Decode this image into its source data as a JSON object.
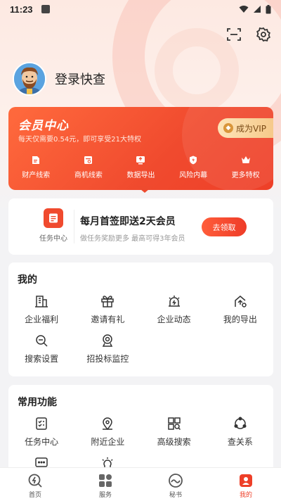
{
  "status_bar": {
    "time": "11:23"
  },
  "profile": {
    "login_text": "登录快查"
  },
  "vip": {
    "title": "会员中心",
    "subtitle": "每天仅需要0.54元，即可享受21大特权",
    "button_label": "成为VIP",
    "perks": [
      {
        "label": "财产线索",
        "icon": "property-icon"
      },
      {
        "label": "商机线索",
        "icon": "business-lead-icon"
      },
      {
        "label": "数据导出",
        "icon": "export-icon"
      },
      {
        "label": "风险内幕",
        "icon": "risk-shield-icon"
      },
      {
        "label": "更多特权",
        "icon": "crown-icon"
      }
    ]
  },
  "task": {
    "label": "任务中心",
    "title": "每月首签即送2天会员",
    "description": "做任务奖励更多 最高可得3年会员",
    "button_label": "去领取"
  },
  "mine": {
    "title": "我的",
    "items": [
      {
        "label": "企业福利",
        "icon": "building-icon"
      },
      {
        "label": "邀请有礼",
        "icon": "gift-icon"
      },
      {
        "label": "企业动态",
        "icon": "alert-light-icon"
      },
      {
        "label": "我的导出",
        "icon": "cloud-export-icon"
      },
      {
        "label": "搜索设置",
        "icon": "search-settings-icon"
      },
      {
        "label": "招投标监控",
        "icon": "camera-monitor-icon"
      }
    ]
  },
  "common": {
    "title": "常用功能",
    "items": [
      {
        "label": "任务中心",
        "icon": "task-list-icon"
      },
      {
        "label": "附近企业",
        "icon": "location-pin-icon"
      },
      {
        "label": "高级搜索",
        "icon": "advanced-search-icon"
      },
      {
        "label": "查关系",
        "icon": "relation-graph-icon"
      }
    ]
  },
  "bottom_nav": [
    {
      "label": "首页",
      "icon": "home-icon",
      "active": false
    },
    {
      "label": "服务",
      "icon": "services-grid-icon",
      "active": false
    },
    {
      "label": "秘书",
      "icon": "secretary-icon",
      "active": false
    },
    {
      "label": "我的",
      "icon": "profile-icon",
      "active": true
    }
  ],
  "colors": {
    "accent": "#ee3f28",
    "vip_gold": "#f6c98a"
  }
}
